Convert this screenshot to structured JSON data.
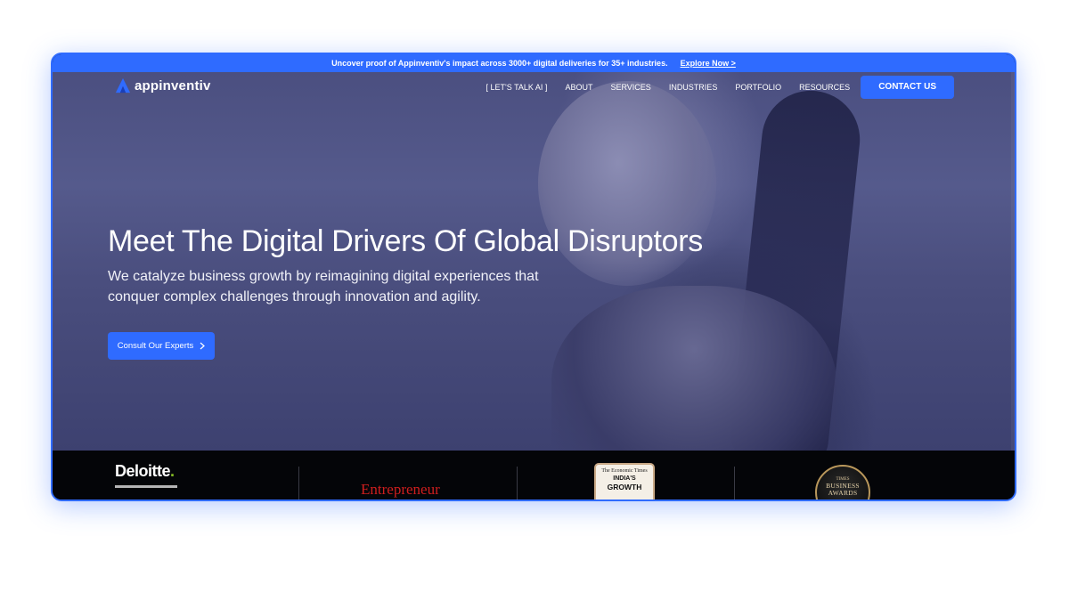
{
  "promo": {
    "text": "Uncover proof of Appinventiv's impact across 3000+ digital deliveries for 35+ industries.",
    "link": "Explore Now >"
  },
  "brand": {
    "name": "appinventiv",
    "icon": "triangle-logo-icon"
  },
  "nav": {
    "items": [
      "[ LET'S TALK AI ]",
      "ABOUT",
      "SERVICES",
      "INDUSTRIES",
      "PORTFOLIO",
      "RESOURCES"
    ],
    "cta": "CONTACT US"
  },
  "hero": {
    "title": "Meet The Digital Drivers Of Global Disruptors",
    "subtitle": "We catalyze business growth by reimagining digital experiences that conquer complex challenges through innovation and agility.",
    "cta_label": "Consult Our Experts",
    "cta_icon": "chevron-right-icon"
  },
  "partners": {
    "deloitte": "Deloitte",
    "deloitte_dot": ".",
    "entrepreneur": "Entrepreneur",
    "et_top": "The Economic Times",
    "et_line1": "INDIA'S",
    "et_line2": "GROWTH",
    "tba_small": "TIMES",
    "tba_line1": "BUSINESS",
    "tba_line2": "AWARDS"
  },
  "colors": {
    "accent": "#2f6bff",
    "hero_tint": "#4b4f80",
    "strip_bg": "#040508"
  }
}
